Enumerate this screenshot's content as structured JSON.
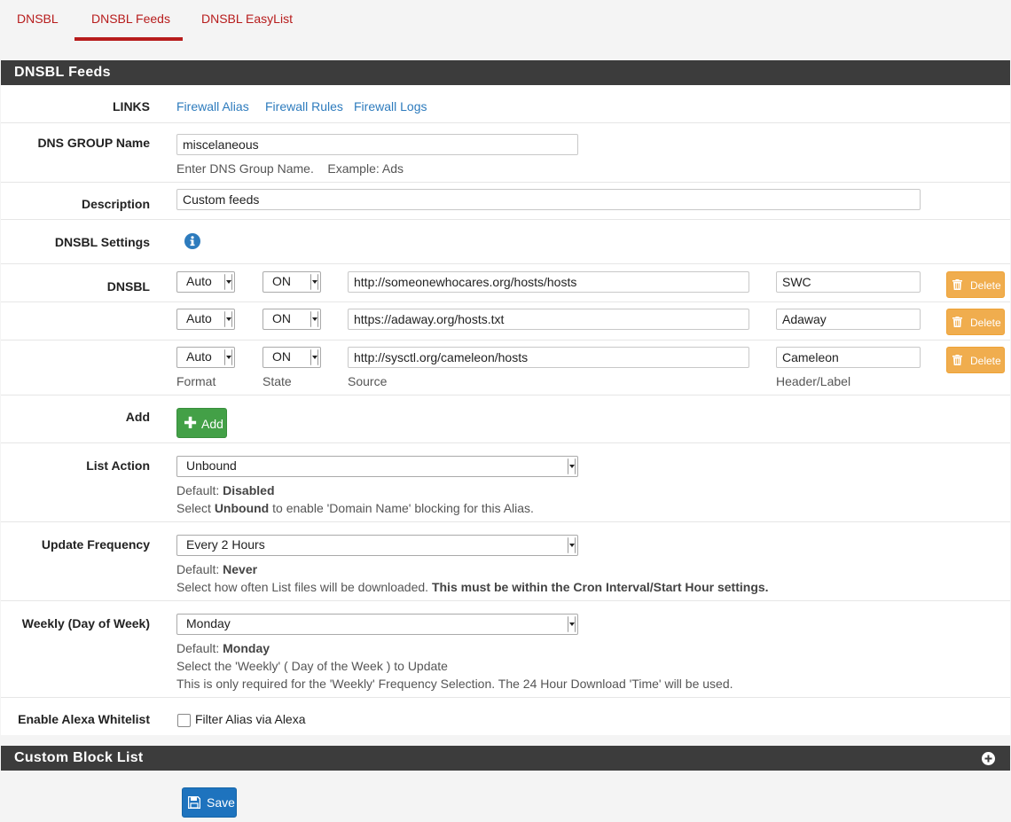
{
  "tabs": [
    {
      "label": "DNSBL",
      "active": false
    },
    {
      "label": "DNSBL Feeds",
      "active": true
    },
    {
      "label": "DNSBL EasyList",
      "active": false
    }
  ],
  "panel_title": "DNSBL Feeds",
  "links": {
    "label": "LINKS",
    "items": [
      "Firewall Alias",
      "Firewall Rules",
      "Firewall Logs"
    ]
  },
  "group_name": {
    "label": "DNS GROUP Name",
    "value": "miscelaneous",
    "help": "Enter DNS Group Name.    Example: Ads"
  },
  "description": {
    "label": "Description",
    "value": "Custom feeds"
  },
  "settings": {
    "label": "DNSBL Settings",
    "icon": "info-icon"
  },
  "dnsbl": {
    "label": "DNSBL",
    "delete_label": "Delete",
    "entries": [
      {
        "format": "Auto",
        "state": "ON",
        "source": "http://someonewhocares.org/hosts/hosts",
        "header": "SWC"
      },
      {
        "format": "Auto",
        "state": "ON",
        "source": "https://adaway.org/hosts.txt",
        "header": "Adaway"
      },
      {
        "format": "Auto",
        "state": "ON",
        "source": "http://sysctl.org/cameleon/hosts",
        "header": "Cameleon"
      }
    ],
    "column_labels": {
      "format": "Format",
      "state": "State",
      "source": "Source",
      "header": "Header/Label"
    }
  },
  "add": {
    "label": "Add",
    "button_label": "Add"
  },
  "list_action": {
    "label": "List Action",
    "value": "Unbound",
    "default_prefix": "Default: ",
    "default_value": "Disabled",
    "help_prefix": "Select ",
    "help_bold": "Unbound",
    "help_suffix": " to enable 'Domain Name' blocking for this Alias."
  },
  "update_frequency": {
    "label": "Update Frequency",
    "value": "Every 2 Hours",
    "default_prefix": "Default: ",
    "default_value": "Never",
    "help_prefix": "Select how often List files will be downloaded. ",
    "help_bold": "This must be within the Cron Interval/Start Hour settings."
  },
  "weekly": {
    "label": "Weekly (Day of Week)",
    "value": "Monday",
    "default_prefix": "Default: ",
    "default_value": "Monday",
    "help_line1": "Select the 'Weekly' ( Day of the Week ) to Update",
    "help_line2": "This is only required for the 'Weekly' Frequency Selection. The 24 Hour Download 'Time' will be used."
  },
  "alexa": {
    "label": "Enable Alexa Whitelist",
    "checkbox_label": "Filter Alias via Alexa",
    "checked": false
  },
  "custom_block_list": {
    "title": "Custom Block List",
    "icon": "plus-circle-icon"
  },
  "save_label": "Save",
  "colors": {
    "tab_active": "#b71c1c",
    "panel_heading": "#3c3c3c",
    "link": "#2d7bbd",
    "delete_button": "#f0ad4e",
    "add_button": "#43a047",
    "save_button": "#1e73be"
  }
}
